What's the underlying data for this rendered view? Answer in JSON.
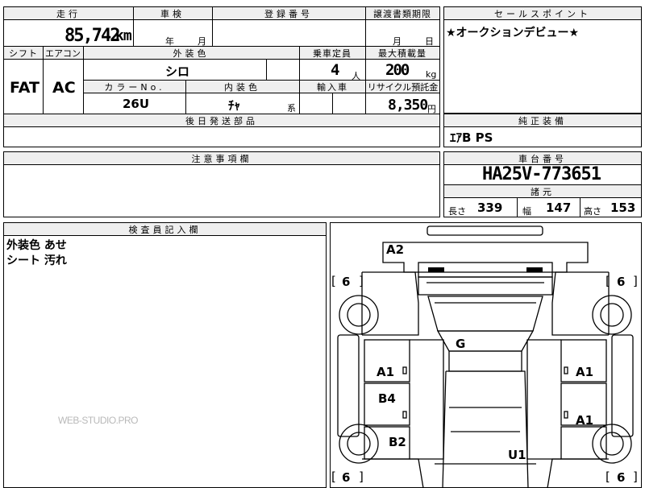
{
  "top": {
    "h1": "走行",
    "h2": "車検",
    "h3": "登録番号",
    "h4": "譲渡書類期限"
  },
  "mileage": {
    "value": "85,742",
    "unit": "km"
  },
  "shaken": {
    "year": "年",
    "month": "月"
  },
  "deadline": {
    "month": "月",
    "day": "日"
  },
  "row2": {
    "shift": "シフト",
    "aircon": "エアコン",
    "color": "外装色",
    "capacity": "乗車定員",
    "load": "最大積載量"
  },
  "values": {
    "shift": "FAT",
    "aircon": "AC",
    "color": "シロ",
    "capacity": "4",
    "capacity_unit": "人",
    "load": "200",
    "load_unit": "kg"
  },
  "row3": {
    "colorno": "カラーNo.",
    "interior": "内装色",
    "import": "輸入車",
    "recycle": "リサイクル預託金"
  },
  "values3": {
    "colorno": "26U",
    "interior": "ﾁｬ",
    "interior_suffix": "系",
    "recycle": "8,350",
    "recycle_unit": "円"
  },
  "later_parts": {
    "label": "後日発送部品"
  },
  "sales": {
    "label": "セールスポイント",
    "text": "★オークションデビュー★"
  },
  "genuine": {
    "label": "純正装備",
    "text": "ｴｱB PS"
  },
  "caution": {
    "label": "注意事項欄"
  },
  "chassis": {
    "label": "車台番号",
    "value": "HA25V-773651"
  },
  "dims": {
    "label": "諸元",
    "len_label": "長さ",
    "len": "339",
    "wid_label": "幅",
    "wid": "147",
    "hei_label": "高さ",
    "hei": "153"
  },
  "inspector": {
    "label": "検査員記入欄",
    "line1": "外装色 あせ",
    "line2": "シート 汚れ"
  },
  "watermark": "WEB-STUDIO.PRO",
  "diagram": {
    "a2": "A2",
    "g": "G",
    "a1_left": "A1",
    "b4": "B4",
    "b2": "B2",
    "a1_right_top": "A1",
    "a1_right_bot": "A1",
    "u1": "U1",
    "tl": "6",
    "tr": "6",
    "bl": "6",
    "br": "6",
    "lb": "[",
    "rb": "]"
  }
}
